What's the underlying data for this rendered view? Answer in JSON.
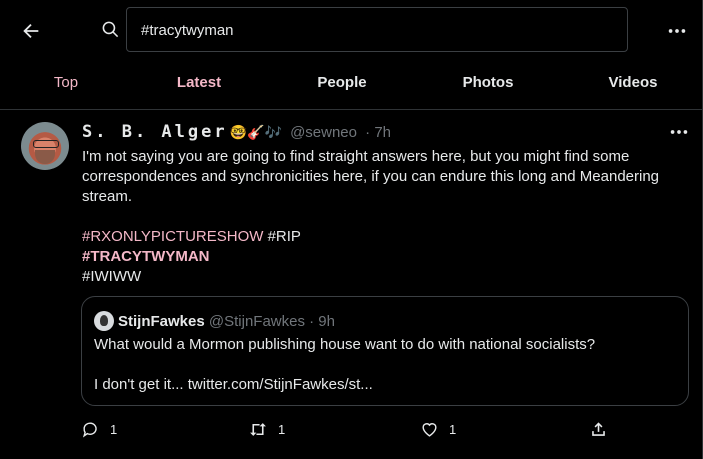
{
  "search": {
    "value": "#tracytwyman"
  },
  "tabs": [
    {
      "label": "Top"
    },
    {
      "label": "Latest"
    },
    {
      "label": "People"
    },
    {
      "label": "Photos"
    },
    {
      "label": "Videos"
    }
  ],
  "tweet": {
    "display_name": "S. B. Alger",
    "name_emoji": "🤓🎸🎶",
    "handle": "@sewneo",
    "time": "· 7h",
    "text_line1": "I'm not saying you are going to find straight answers here, but you might find some correspondences and synchronicities here, if you can endure this long and Meandering stream.",
    "hashtag1": "#RXONLYPICTURESHOW",
    "hashtag2": "#RIP",
    "hashtag3": "#TRACYTWYMAN",
    "hashtag4": "#IWIWW",
    "quote": {
      "name": "StijnFawkes",
      "handle": "@StijnFawkes",
      "time": "· 9h",
      "line1": "What would a Mormon publishing house want to do with national socialists?",
      "line2": "I don't get it... twitter.com/StijnFawkes/st..."
    },
    "replies": "1",
    "retweets": "1",
    "likes": "1"
  },
  "colors": {
    "accent": "#f4b8c8",
    "background": "#000000",
    "text": "#e7e9ea",
    "muted": "#71767b",
    "border": "#2f3336"
  },
  "icons": [
    "back-arrow-icon",
    "search-icon",
    "more-icon",
    "reply-icon",
    "retweet-icon",
    "like-icon",
    "share-icon"
  ]
}
